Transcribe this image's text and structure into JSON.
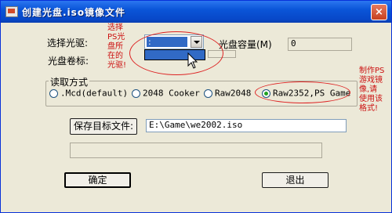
{
  "window": {
    "title": "创建光盘.iso镜像文件",
    "close_label": "×"
  },
  "drive": {
    "label": "选择光驱:",
    "selected_value": ":",
    "capacity_label": "光盘容量(M)",
    "capacity_value": "0",
    "volume_label": "光盘卷标:",
    "volume_value": ""
  },
  "read_mode": {
    "group_label": "读取方式",
    "options": [
      {
        "label": ".Mcd(default)",
        "selected": false
      },
      {
        "label": "2048 Cooker",
        "selected": false
      },
      {
        "label": "Raw2048",
        "selected": false
      },
      {
        "label": "Raw2352,PS Game",
        "selected": true
      }
    ]
  },
  "target": {
    "button_label": "保存目标文件:",
    "path_value": "E:\\Game\\we2002.iso"
  },
  "progress": {
    "value": 0
  },
  "buttons": {
    "ok": "确定",
    "cancel": "退出"
  },
  "annotations": {
    "drive_note": [
      "选择",
      "PS光",
      "盘所",
      "在的",
      "光驱!"
    ],
    "mode_note": [
      "制作PS",
      "游戏镜",
      "像,请",
      "使用该",
      "格式!"
    ]
  },
  "colors": {
    "titlebar": "#0a55d8",
    "dialog_bg": "#ece9d8",
    "selection": "#316ac5",
    "annotation": "#cc1111"
  }
}
